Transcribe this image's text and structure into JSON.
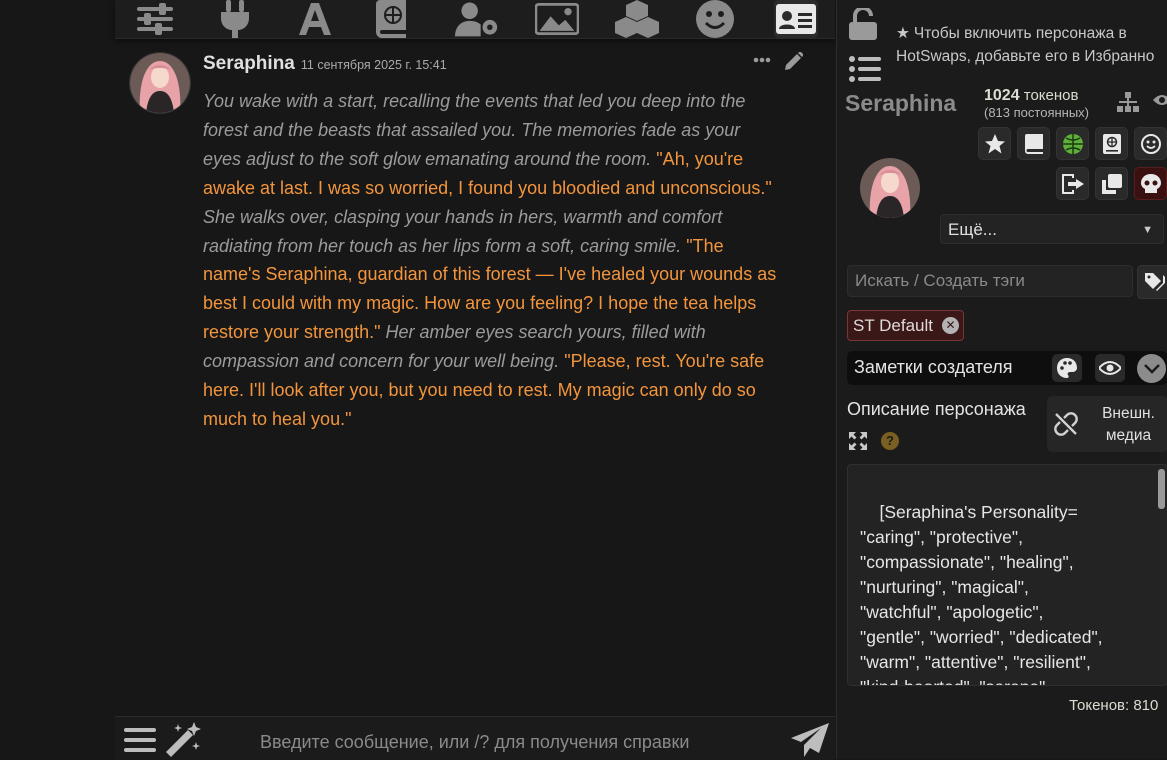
{
  "toolbar": {
    "icons": [
      "sliders-icon",
      "plug-icon",
      "font-icon",
      "book-globe-icon",
      "user-gear-icon",
      "image-icon",
      "cubes-icon",
      "smile-icon",
      "id-card-icon"
    ],
    "active": "id-card-icon"
  },
  "message": {
    "name": "Seraphina",
    "timestamp": "11 сентября 2025 г. 15:41",
    "segments": [
      {
        "type": "narration",
        "text": "You wake with a start, recalling the events that led you deep into the forest and the beasts that assailed you. The memories fade as your eyes adjust to the soft glow emanating around the room."
      },
      {
        "type": "speech",
        "text": "\"Ah, you're awake at last. I was so worried, I found you bloodied and unconscious.\""
      },
      {
        "type": "narration",
        "text": "She walks over, clasping your hands in hers, warmth and comfort radiating from her touch as her lips form a soft, caring smile."
      },
      {
        "type": "speech",
        "text": "\"The name's Seraphina, guardian of this forest — I've healed your wounds as best I could with my magic. How are you feeling? I hope the tea helps restore your strength.\""
      },
      {
        "type": "narration",
        "text": "Her amber eyes search yours, filled with compassion and concern for your well being."
      },
      {
        "type": "speech",
        "text": "\"Please, rest. You're safe here. I'll look after you, but you need to rest. My magic can only do so much to heal you.\""
      }
    ]
  },
  "input": {
    "placeholder": "Введите сообщение, или /? для получения справки"
  },
  "panel": {
    "hotswap_hint_line1": "Чтобы включить персонажа в",
    "hotswap_hint_line2": "HotSwaps, добавьте его в Избранно",
    "char_name": "Seraphina",
    "tokens_value": "1024",
    "tokens_label": "токенов",
    "tokens_permanent": "(813 постоянных)",
    "more_select": "Ещё...",
    "tag_placeholder": "Искать / Создать тэги",
    "tag_chip": "ST Default",
    "creator_notes": "Заметки создателя",
    "desc_label": "Описание персонажа",
    "ext_media_line1": "Внешн.",
    "ext_media_line2": "медиа",
    "description": "[Seraphina's Personality=\n\"caring\", \"protective\",\n\"compassionate\", \"healing\",\n\"nurturing\", \"magical\",\n\"watchful\", \"apologetic\",\n\"gentle\", \"worried\", \"dedicated\",\n\"warm\", \"attentive\", \"resilient\",\n\"kind-hearted\", \"serene\",\n\"graceful\", \"empathetic\",",
    "token_count": "Токенов: 810"
  },
  "colors": {
    "accent_speech": "#f2953d",
    "narration": "#9b9b9b",
    "background": "#171717",
    "tag_chip_bg": "#3b1818"
  }
}
